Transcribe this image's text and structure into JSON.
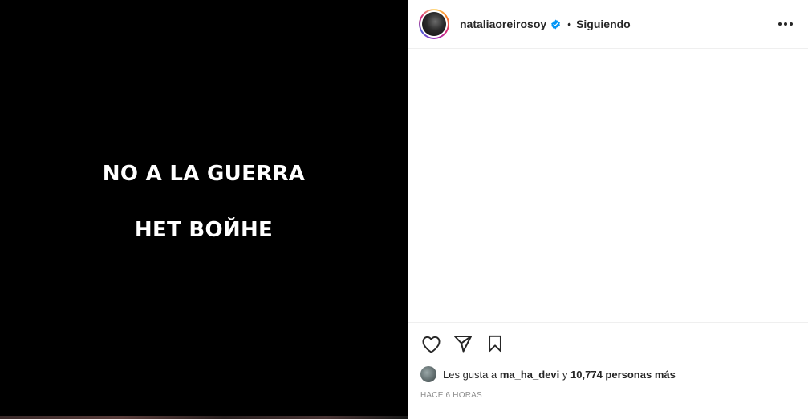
{
  "post": {
    "image_text": {
      "line1": "NO A LA GUERRA",
      "line2": "НЕТ ВОЙНЕ"
    }
  },
  "header": {
    "username": "nataliaoreirosoy",
    "verified_icon": "verified-badge-icon",
    "separator": "•",
    "follow_status": "Siguiendo",
    "more_icon": "more-options-icon"
  },
  "actions": {
    "like_icon": "heart-icon",
    "share_icon": "paper-plane-icon",
    "save_icon": "bookmark-icon"
  },
  "likes": {
    "prefix": "Les gusta a",
    "user": "ma_ha_devi",
    "joiner": "y",
    "others": "10,774 personas más"
  },
  "timestamp": "HACE 6 HORAS",
  "colors": {
    "text": "#262626",
    "secondary": "#8e8e8e",
    "verified": "#0095f6",
    "border": "#efefef"
  }
}
